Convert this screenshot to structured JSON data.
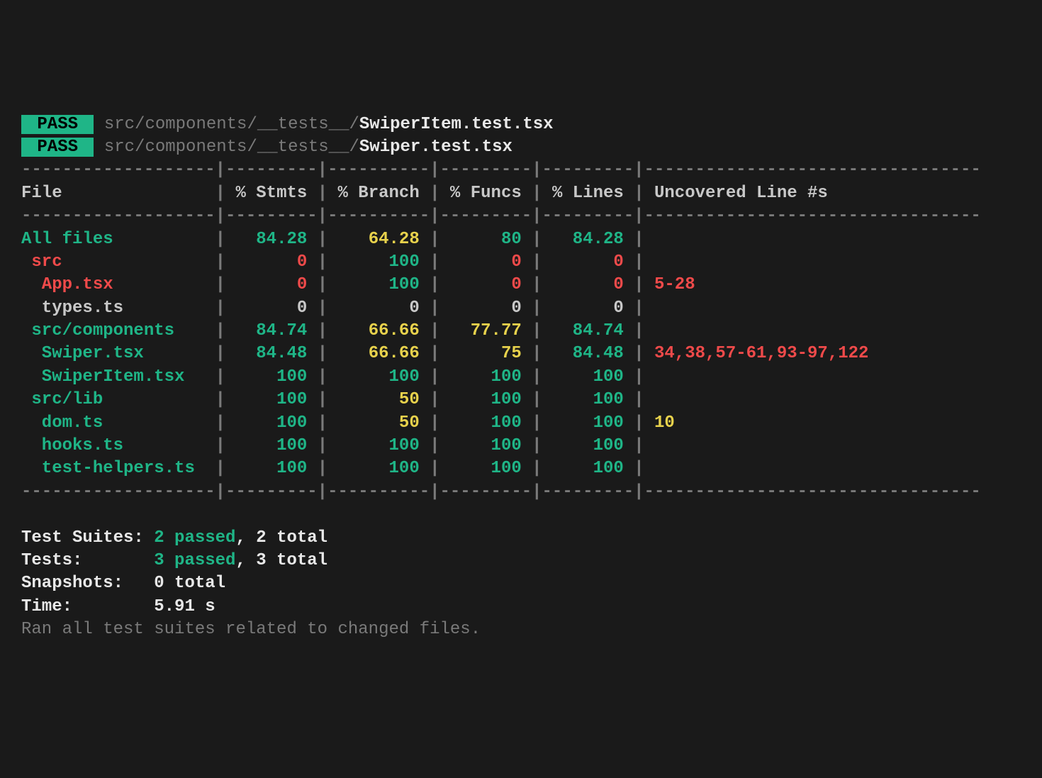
{
  "pass_label": "PASS",
  "tests_run": [
    {
      "dir": "src/components/__tests__/",
      "file": "SwiperItem.test.tsx"
    },
    {
      "dir": "src/components/__tests__/",
      "file": "Swiper.test.tsx"
    }
  ],
  "columns": {
    "file": "File",
    "stmts": "% Stmts",
    "branch": "% Branch",
    "funcs": "% Funcs",
    "lines": "% Lines",
    "uncov": "Uncovered Line #s"
  },
  "rows": [
    {
      "indent": 0,
      "name": "All files",
      "name_color": "green",
      "stmts": {
        "v": "84.28",
        "c": "green"
      },
      "branch": {
        "v": "64.28",
        "c": "yellow"
      },
      "funcs": {
        "v": "80",
        "c": "green"
      },
      "lines": {
        "v": "84.28",
        "c": "green"
      },
      "uncov": {
        "v": "",
        "c": "white"
      }
    },
    {
      "indent": 1,
      "name": "src",
      "name_color": "red",
      "stmts": {
        "v": "0",
        "c": "red"
      },
      "branch": {
        "v": "100",
        "c": "green"
      },
      "funcs": {
        "v": "0",
        "c": "red"
      },
      "lines": {
        "v": "0",
        "c": "red"
      },
      "uncov": {
        "v": "",
        "c": "white"
      }
    },
    {
      "indent": 2,
      "name": "App.tsx",
      "name_color": "red",
      "stmts": {
        "v": "0",
        "c": "red"
      },
      "branch": {
        "v": "100",
        "c": "green"
      },
      "funcs": {
        "v": "0",
        "c": "red"
      },
      "lines": {
        "v": "0",
        "c": "red"
      },
      "uncov": {
        "v": "5-28",
        "c": "red"
      }
    },
    {
      "indent": 2,
      "name": "types.ts",
      "name_color": "white",
      "stmts": {
        "v": "0",
        "c": "white"
      },
      "branch": {
        "v": "0",
        "c": "white"
      },
      "funcs": {
        "v": "0",
        "c": "white"
      },
      "lines": {
        "v": "0",
        "c": "white"
      },
      "uncov": {
        "v": "",
        "c": "white"
      }
    },
    {
      "indent": 1,
      "name": "src/components",
      "name_color": "green",
      "stmts": {
        "v": "84.74",
        "c": "green"
      },
      "branch": {
        "v": "66.66",
        "c": "yellow"
      },
      "funcs": {
        "v": "77.77",
        "c": "yellow"
      },
      "lines": {
        "v": "84.74",
        "c": "green"
      },
      "uncov": {
        "v": "",
        "c": "white"
      }
    },
    {
      "indent": 2,
      "name": "Swiper.tsx",
      "name_color": "green",
      "stmts": {
        "v": "84.48",
        "c": "green"
      },
      "branch": {
        "v": "66.66",
        "c": "yellow"
      },
      "funcs": {
        "v": "75",
        "c": "yellow"
      },
      "lines": {
        "v": "84.48",
        "c": "green"
      },
      "uncov": {
        "v": "34,38,57-61,93-97,122",
        "c": "red"
      }
    },
    {
      "indent": 2,
      "name": "SwiperItem.tsx",
      "name_color": "green",
      "stmts": {
        "v": "100",
        "c": "green"
      },
      "branch": {
        "v": "100",
        "c": "green"
      },
      "funcs": {
        "v": "100",
        "c": "green"
      },
      "lines": {
        "v": "100",
        "c": "green"
      },
      "uncov": {
        "v": "",
        "c": "white"
      }
    },
    {
      "indent": 1,
      "name": "src/lib",
      "name_color": "green",
      "stmts": {
        "v": "100",
        "c": "green"
      },
      "branch": {
        "v": "50",
        "c": "yellow"
      },
      "funcs": {
        "v": "100",
        "c": "green"
      },
      "lines": {
        "v": "100",
        "c": "green"
      },
      "uncov": {
        "v": "",
        "c": "white"
      }
    },
    {
      "indent": 2,
      "name": "dom.ts",
      "name_color": "green",
      "stmts": {
        "v": "100",
        "c": "green"
      },
      "branch": {
        "v": "50",
        "c": "yellow"
      },
      "funcs": {
        "v": "100",
        "c": "green"
      },
      "lines": {
        "v": "100",
        "c": "green"
      },
      "uncov": {
        "v": "10",
        "c": "yellow"
      }
    },
    {
      "indent": 2,
      "name": "hooks.ts",
      "name_color": "green",
      "stmts": {
        "v": "100",
        "c": "green"
      },
      "branch": {
        "v": "100",
        "c": "green"
      },
      "funcs": {
        "v": "100",
        "c": "green"
      },
      "lines": {
        "v": "100",
        "c": "green"
      },
      "uncov": {
        "v": "",
        "c": "white"
      }
    },
    {
      "indent": 2,
      "name": "test-helpers.ts",
      "name_color": "green",
      "stmts": {
        "v": "100",
        "c": "green"
      },
      "branch": {
        "v": "100",
        "c": "green"
      },
      "funcs": {
        "v": "100",
        "c": "green"
      },
      "lines": {
        "v": "100",
        "c": "green"
      },
      "uncov": {
        "v": "",
        "c": "white"
      }
    }
  ],
  "col_widths": {
    "file": 19,
    "stmts": 9,
    "branch": 10,
    "funcs": 9,
    "lines": 9,
    "uncov": 33
  },
  "summary": {
    "suites_label": "Test Suites:",
    "suites_passed": "2 passed",
    "suites_total": "2 total",
    "tests_label": "Tests:",
    "tests_passed": "3 passed",
    "tests_total": "3 total",
    "snapshots_label": "Snapshots:",
    "snapshots_total": "0 total",
    "time_label": "Time:",
    "time_value": "5.91 s",
    "footer": "Ran all test suites related to changed files."
  }
}
